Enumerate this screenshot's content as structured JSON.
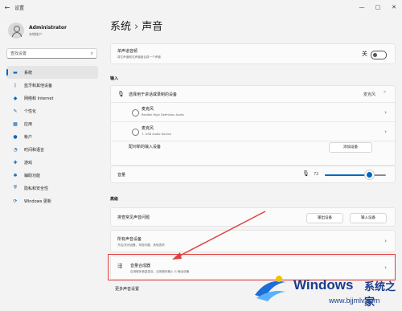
{
  "window": {
    "title": "设置",
    "controls": [
      "—",
      "▢",
      "✕"
    ]
  },
  "profile": {
    "name": "Administrator",
    "account": "本地帐户"
  },
  "search": {
    "placeholder": "查找设置"
  },
  "sidebar": {
    "items": [
      {
        "label": "系统",
        "icon": "monitor-icon",
        "glyph": "▬"
      },
      {
        "label": "蓝牙和其他设备",
        "icon": "bluetooth-icon",
        "glyph": "ᛒ"
      },
      {
        "label": "网络和 Internet",
        "icon": "wifi-icon",
        "glyph": "◆"
      },
      {
        "label": "个性化",
        "icon": "brush-icon",
        "glyph": "✎"
      },
      {
        "label": "应用",
        "icon": "apps-icon",
        "glyph": "▦"
      },
      {
        "label": "帐户",
        "icon": "person-icon",
        "glyph": "●"
      },
      {
        "label": "时间和语言",
        "icon": "clock-globe-icon",
        "glyph": "◔"
      },
      {
        "label": "游戏",
        "icon": "gamepad-icon",
        "glyph": "✚"
      },
      {
        "label": "辅助功能",
        "icon": "accessibility-icon",
        "glyph": "✱"
      },
      {
        "label": "隐私和安全性",
        "icon": "shield-icon",
        "glyph": "⛨"
      },
      {
        "label": "Windows 更新",
        "icon": "update-icon",
        "glyph": "⟳"
      }
    ],
    "active_index": 0,
    "accent": "#0067c0"
  },
  "breadcrumb": {
    "parent": "系统",
    "separator": "›",
    "current": "声音"
  },
  "mono": {
    "title": "单声道音频",
    "sub": "将左声道和右声道组合成一个声道",
    "toggle_state": "关"
  },
  "input": {
    "section_label": "输入",
    "choose_title": "选择用于讲话或录制的设备",
    "choose_value": "麦克风",
    "devices": [
      {
        "name": "麦克风",
        "sub": "Realtek High Definition Audio"
      },
      {
        "name": "麦克风",
        "sub": "7- USB Audio Device"
      }
    ],
    "pair_label": "配对新的输入设备",
    "add_button": "添加设备",
    "volume_label": "音量",
    "volume_value": "72"
  },
  "advanced": {
    "section_label": "高级",
    "troubleshoot_label": "排查常见声音问题",
    "output_button": "输出设备",
    "input_button": "输入设备",
    "all_devices_title": "所有声音设备",
    "all_devices_sub": "开启/关闭设备、排查问题、其他选项",
    "mixer_title": "音量合成器",
    "mixer_sub": "应用程序音量混合、应用程序输入 & 输出设备",
    "more_settings": "更多声音设置"
  },
  "watermark": {
    "brand": "Windows",
    "cn": "系统之家",
    "url": "www.bjjmlv.com"
  }
}
